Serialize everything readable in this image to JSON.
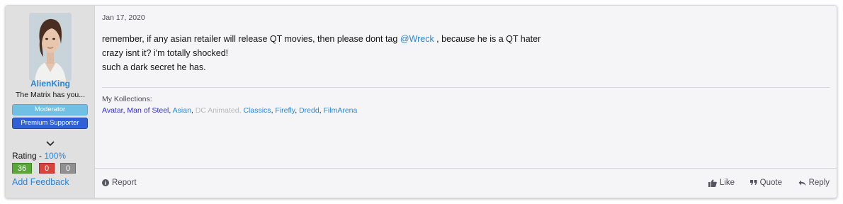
{
  "user": {
    "username": "AlienKing",
    "title": "The Matrix has you...",
    "banners": [
      "Moderator",
      "Premium Supporter"
    ],
    "rating_label": "Rating - ",
    "rating_value": "100%",
    "feedback_positive": "36",
    "feedback_negative": "0",
    "feedback_neutral": "0",
    "add_feedback": "Add Feedback"
  },
  "post": {
    "date": "Jan 17, 2020",
    "line1_before": "remember, if any asian retailer will release QT movies, then please dont tag ",
    "mention": "@Wreck",
    "line1_after": " , because he is a QT hater",
    "line2": "crazy isnt it? i'm totally shocked!",
    "line3": "such a dark secret he has."
  },
  "signature": {
    "label": "My Kollections:",
    "links": [
      "Avatar",
      "Man of Steel",
      "Asian",
      "DC Animated",
      "Classics",
      "Firefly",
      "Dredd",
      "FilmArena"
    ],
    "separator": ", "
  },
  "footer": {
    "report": "Report",
    "like": "Like",
    "quote": "Quote",
    "reply": "Reply"
  },
  "colors": {
    "link": "#2b86d3",
    "moderator_banner": "#6fc0e4",
    "premium_banner": "#3160d6",
    "feedback_positive": "#5aa63b",
    "feedback_negative": "#d8443a",
    "feedback_neutral": "#909090"
  }
}
